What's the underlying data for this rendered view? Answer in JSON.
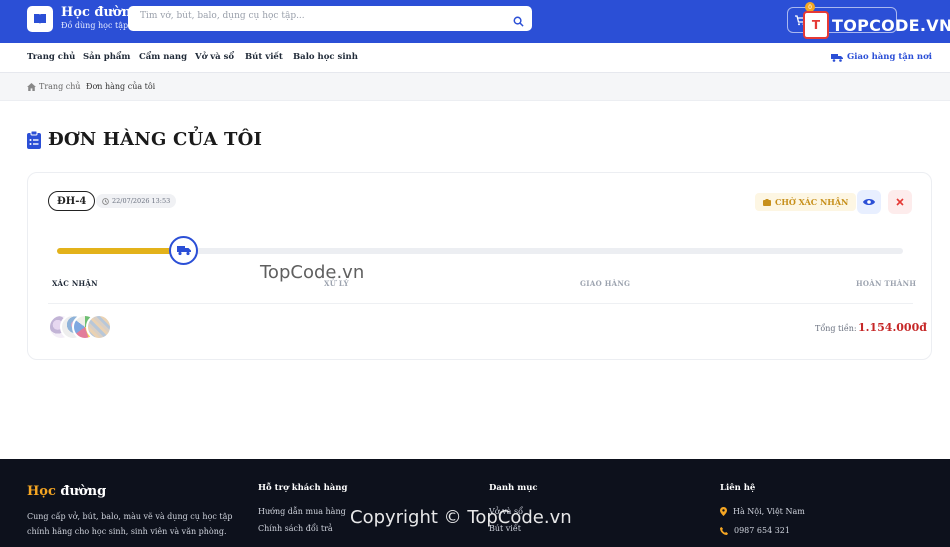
{
  "header": {
    "brand_title": "Học đường",
    "brand_subtitle": "Đồ dùng học tập",
    "search_placeholder": "Tìm vở, bút, balo, dụng cụ học tập...",
    "cart_count": "0",
    "watermark_logo": "TOPCODE.VN"
  },
  "nav": {
    "items": [
      "Trang chủ",
      "Sản phẩm",
      "Cẩm nang",
      "Vở và sổ",
      "Bút viết",
      "Balo học sinh"
    ],
    "shipping": "Giao hàng tận nơi"
  },
  "breadcrumb": {
    "home": "Trang chủ",
    "current": "Đơn hàng của tôi"
  },
  "page": {
    "title": "ĐƠN HÀNG CỦA TÔI"
  },
  "order": {
    "id": "ĐH-4",
    "time": "22/07/2026 13:53",
    "status": "CHỜ XÁC NHẬN",
    "progress": 0.15,
    "steps": [
      "XÁC NHẬN",
      "XỬ LÝ",
      "GIAO HÀNG",
      "HOÀN THÀNH"
    ],
    "total_label": "Tổng tiền:",
    "total_value": "1.154.000đ"
  },
  "watermarks": {
    "middle": "TopCode.vn",
    "copyright": "Copyright © TopCode.vn"
  },
  "footer": {
    "brand_first": "Học",
    "brand_second": " đường",
    "description": "Cung cấp vở, bút, balo, màu vẽ và dụng cụ học tập chính hãng cho học sinh, sinh viên và văn phòng.",
    "support_title": "Hỗ trợ khách hàng",
    "support_links": [
      "Hướng dẫn mua hàng",
      "Chính sách đổi trả"
    ],
    "category_title": "Danh mục",
    "category_links": [
      "Vở và sổ",
      "Bút viết"
    ],
    "contact_title": "Liên hệ",
    "contact_address": "Hà Nội, Việt Nam",
    "contact_phone": "0987 654 321"
  },
  "colors": {
    "primary": "#2b4fd6",
    "accent": "#f5a623",
    "price": "#c62828",
    "progress": "#e3b21a"
  }
}
